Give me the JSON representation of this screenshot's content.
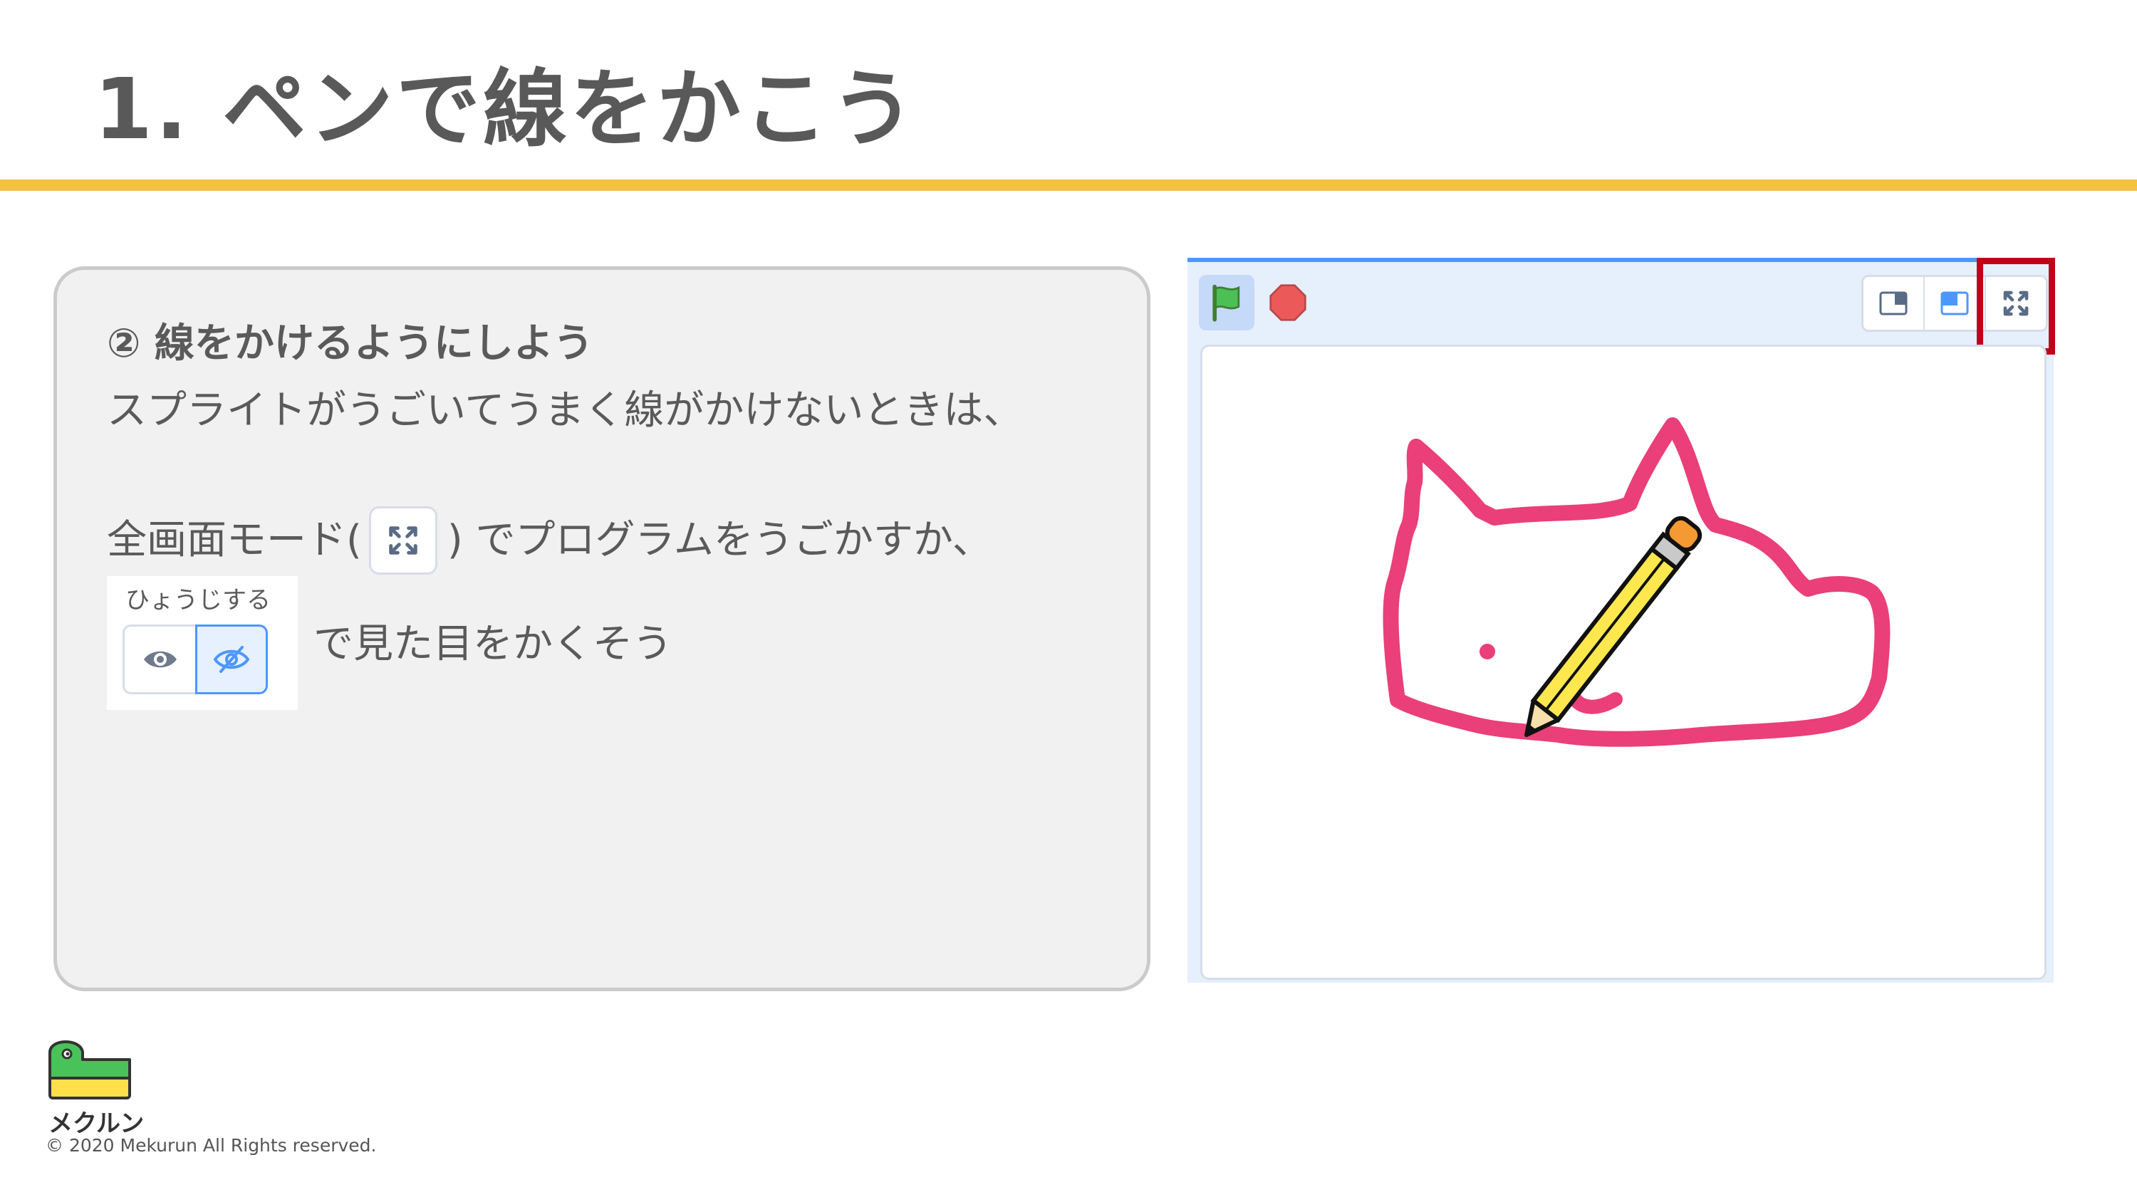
{
  "slide": {
    "title": "1. ペンで線をかこう",
    "accent_color": "#f6c143"
  },
  "instruction": {
    "step": "② 線をかけるようにしよう",
    "line1": "スプライトがうごいてうまく線がかけないときは、",
    "line2_before": "全画面モード(",
    "line2_after": ") でプログラムをうごかすか、",
    "visibility_label": "ひょうじする",
    "line3": "で見た目をかくそう"
  },
  "stage": {
    "green_flag": "green-flag-icon",
    "stop": "stop-icon",
    "modes": [
      "small-stage-icon",
      "normal-stage-icon",
      "fullscreen-icon"
    ],
    "highlight_color": "#c2001a",
    "canvas_content": "cat-outline-drawing-with-pencil"
  },
  "footer": {
    "brand": "メクルン",
    "copyright": "© 2020 Mekurun All Rights reserved."
  }
}
